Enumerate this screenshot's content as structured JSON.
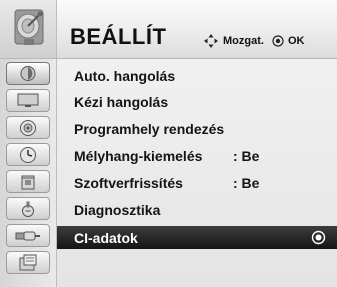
{
  "header": {
    "title": "BEÁLLÍT",
    "nav_hint": "Mozgat.",
    "ok_hint": "OK",
    "icon": "satellite-dish-icon"
  },
  "sidebar": {
    "icons": [
      {
        "name": "picture-icon",
        "active": true
      },
      {
        "name": "tv-screen-icon",
        "active": false
      },
      {
        "name": "speaker-icon",
        "active": false
      },
      {
        "name": "clock-icon",
        "active": false
      },
      {
        "name": "lock-icon",
        "active": false
      },
      {
        "name": "input-icon",
        "active": false
      },
      {
        "name": "usb-icon",
        "active": false
      },
      {
        "name": "help-icon",
        "active": false
      }
    ]
  },
  "menu": {
    "items": [
      {
        "label": "Auto. hangolás",
        "value": ""
      },
      {
        "label": "Kézi hangolás",
        "value": ""
      },
      {
        "label": "Programhely rendezés",
        "value": ""
      },
      {
        "label": "Mélyhang-kiemelés",
        "value": ": Be"
      },
      {
        "label": "Szoftverfrissítés",
        "value": ": Be"
      },
      {
        "label": "Diagnosztika",
        "value": ""
      },
      {
        "label": "CI-adatok",
        "value": "",
        "selected": true
      }
    ]
  },
  "colors": {
    "selected_bg": "#1e1e1e",
    "selected_text": "#ffffff",
    "panel_bg": "#ececec"
  }
}
